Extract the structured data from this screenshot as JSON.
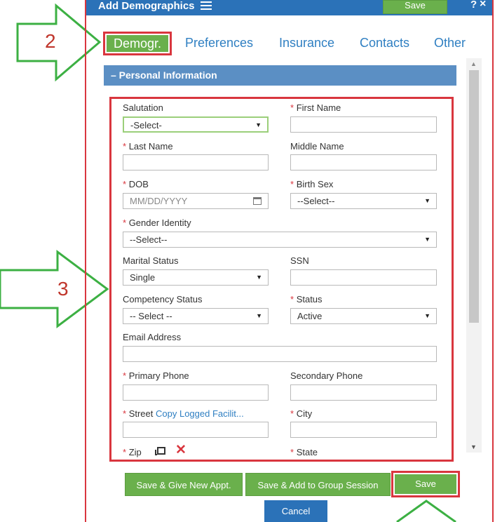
{
  "header": {
    "title": "Add Demographics",
    "save_label": "Save",
    "help_label": "?",
    "close_label": "×"
  },
  "tabs": [
    {
      "label": "Demogr.",
      "active": true
    },
    {
      "label": "Preferences",
      "active": false
    },
    {
      "label": "Insurance",
      "active": false
    },
    {
      "label": "Contacts",
      "active": false
    },
    {
      "label": "Other",
      "active": false
    }
  ],
  "section": {
    "title": "– Personal Information"
  },
  "form": {
    "salutation": {
      "label": "Salutation",
      "value": "-Select-"
    },
    "first_name": {
      "label": "First Name",
      "value": ""
    },
    "last_name": {
      "label": "Last Name",
      "value": ""
    },
    "middle_name": {
      "label": "Middle Name",
      "value": ""
    },
    "dob": {
      "label": "DOB",
      "placeholder": "MM/DD/YYYY"
    },
    "birth_sex": {
      "label": "Birth Sex",
      "value": "--Select--"
    },
    "gender_identity": {
      "label": "Gender Identity",
      "value": "--Select--"
    },
    "marital_status": {
      "label": "Marital Status",
      "value": "Single"
    },
    "ssn": {
      "label": "SSN",
      "value": ""
    },
    "competency_status": {
      "label": "Competency Status",
      "value": "-- Select --"
    },
    "status": {
      "label": "Status",
      "value": "Active"
    },
    "email": {
      "label": "Email Address",
      "value": ""
    },
    "primary_phone": {
      "label": "Primary Phone",
      "value": ""
    },
    "secondary_phone": {
      "label": "Secondary Phone",
      "value": ""
    },
    "street": {
      "label": "Street",
      "link": "Copy Logged Facilit..."
    },
    "city": {
      "label": "City",
      "value": ""
    },
    "zip": {
      "label": "Zip"
    },
    "state": {
      "label": "State"
    },
    "required_marker": "*"
  },
  "buttons": {
    "save_new_appt": "Save & Give New Appt.",
    "save_group": "Save & Add to Group Session",
    "save": "Save",
    "cancel": "Cancel"
  },
  "annotations": {
    "step2": "2",
    "step3": "3"
  },
  "colors": {
    "header_blue": "#2b72b8",
    "tab_link": "#2f7fc2",
    "button_green": "#6ab04c",
    "section_blue": "#5b8fc4",
    "highlight_red": "#d9363e",
    "arrow_green": "#3cb043"
  }
}
